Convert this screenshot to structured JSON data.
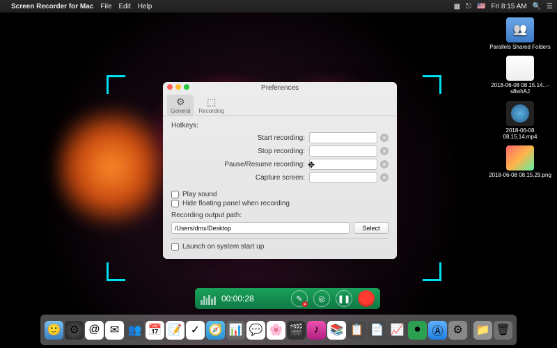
{
  "menubar": {
    "app_name": "Screen Recorder for Mac",
    "menus": [
      "File",
      "Edit",
      "Help"
    ],
    "clock": "Fri 8:15 AM"
  },
  "desktop_icons": [
    {
      "label": "Parallels Shared Folders",
      "type": "folder"
    },
    {
      "label": "2018-06-08 08.15.14...-s8whAJ",
      "type": "file"
    },
    {
      "label": "2018-06-08 08.15.14.mp4",
      "type": "mp4"
    },
    {
      "label": "2018-06-08 08.15.29.png",
      "type": "png"
    }
  ],
  "prefs": {
    "title": "Preferences",
    "tabs": {
      "general": "General",
      "recording": "Recording"
    },
    "hotkeys_label": "Hotkeys:",
    "rows": {
      "start": "Start recording:",
      "stop": "Stop recording:",
      "pause": "Pause/Resume recording:",
      "capture": "Capture screen:"
    },
    "play_sound": "Play sound",
    "hide_panel": "Hide floating panel when recording",
    "output_label": "Recording output path:",
    "output_path": "/Users/dmx/Desktop",
    "select_btn": "Select",
    "launch_startup": "Launch on system start up"
  },
  "rec_toolbar": {
    "timer": "00:00:28"
  }
}
